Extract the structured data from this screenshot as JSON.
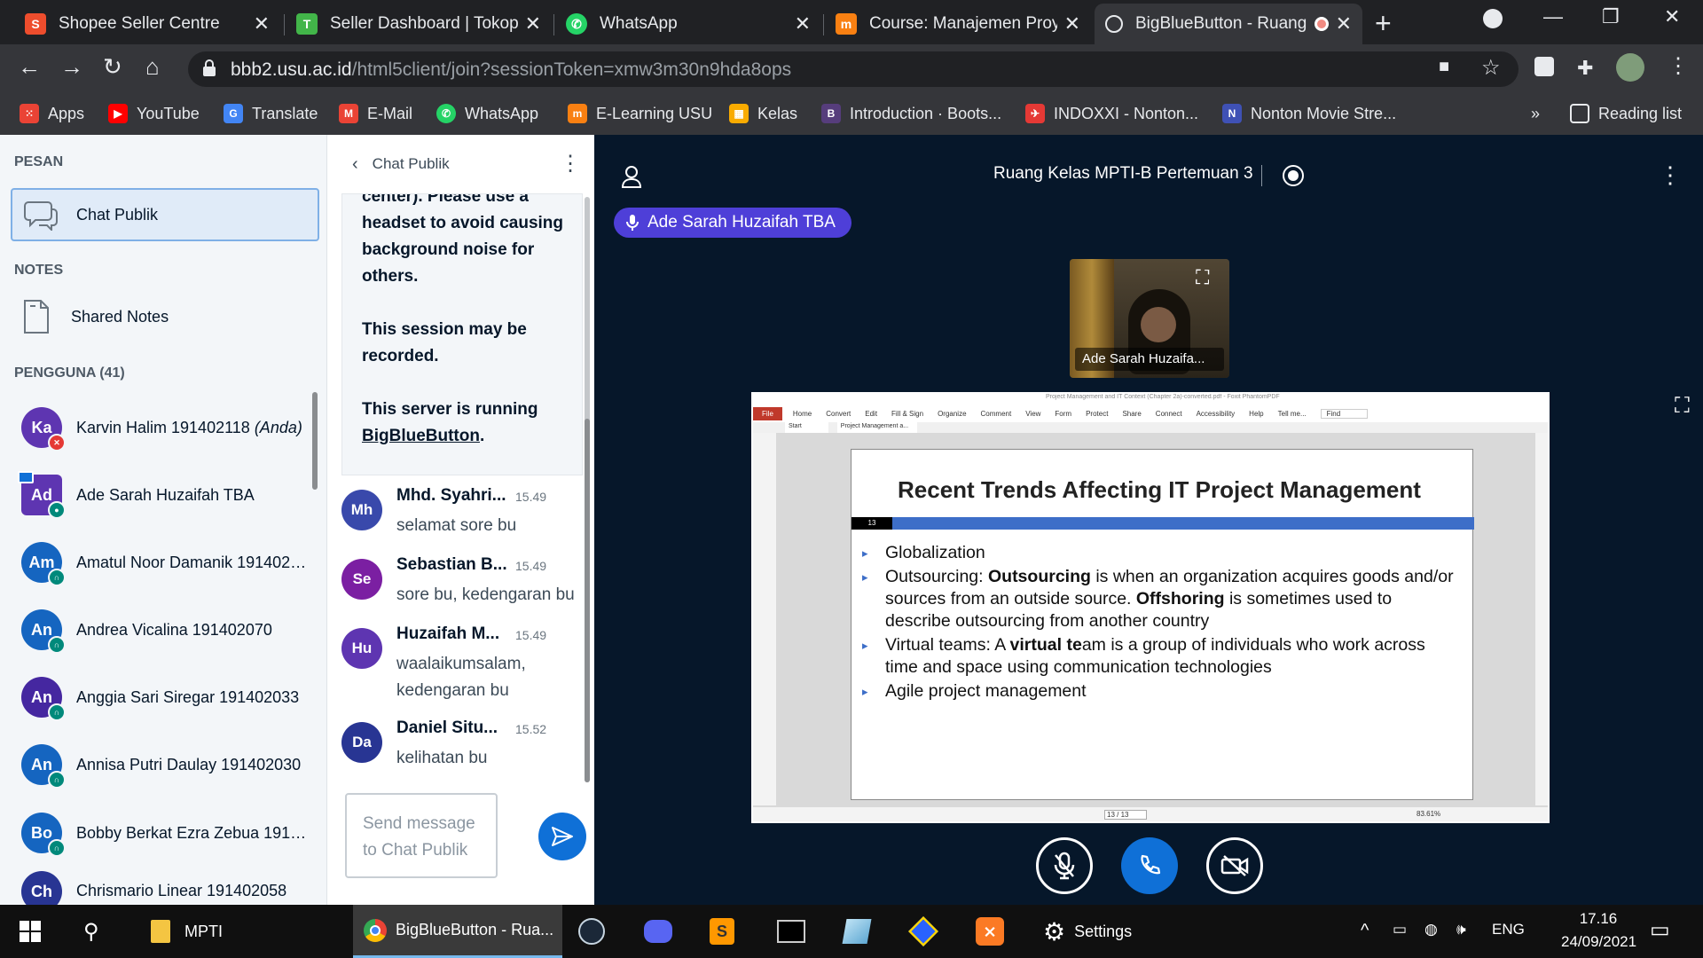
{
  "browser": {
    "tabs": [
      {
        "title": "Shopee Seller Centre",
        "icon": "shopee-icon",
        "color": "#ee4d2d"
      },
      {
        "title": "Seller Dashboard | Tokope",
        "icon": "tokopedia-icon",
        "color": "#42b549"
      },
      {
        "title": "WhatsApp",
        "icon": "whatsapp-icon",
        "color": "#25d366"
      },
      {
        "title": "Course: Manajemen Proye",
        "icon": "moodle-icon",
        "color": "#f98012"
      },
      {
        "title": "BigBlueButton - Ruang",
        "icon": "globe-icon",
        "color": "#e8eaed",
        "active": true
      }
    ],
    "url_host": "bbb2.usu.ac.id",
    "url_path": "/html5client/join?sessionToken=xmw3m30n9hda8ops",
    "bookmarks": [
      {
        "label": "Apps",
        "icon": "apps-grid-icon",
        "color": "#ea4335"
      },
      {
        "label": "YouTube",
        "icon": "youtube-icon",
        "color": "#ff0000"
      },
      {
        "label": "Translate",
        "icon": "translate-icon",
        "color": "#4285f4"
      },
      {
        "label": "E-Mail",
        "icon": "gmail-icon",
        "color": "#ea4335"
      },
      {
        "label": "WhatsApp",
        "icon": "whatsapp-icon",
        "color": "#25d366"
      },
      {
        "label": "E-Learning USU",
        "icon": "moodle-icon",
        "color": "#f98012"
      },
      {
        "label": "Kelas",
        "icon": "classroom-icon",
        "color": "#f9ab00"
      },
      {
        "label": "Introduction · Boots...",
        "icon": "bootstrap-icon",
        "color": "#563d7c"
      },
      {
        "label": "INDOXXI - Nonton...",
        "icon": "indoxxi-icon",
        "color": "#e53935"
      },
      {
        "label": "Nonton Movie Stre...",
        "icon": "movie-icon",
        "color": "#3f51b5"
      }
    ],
    "bookmarks_overflow": "»",
    "reading_list": "Reading list"
  },
  "sidebar": {
    "messages_header": "PESAN",
    "public_chat": "Chat Publik",
    "notes_header": "NOTES",
    "shared_notes": "Shared Notes",
    "users_header": "PENGGUNA (41)",
    "users": [
      {
        "initials": "Ka",
        "name": "Karvin Halim 191402118",
        "suffix": "(Anda)",
        "color": "#5e35b1",
        "badge": "mic-muted",
        "badge_color": "#e53935"
      },
      {
        "initials": "Ad",
        "name": "Ade Sarah Huzaifah TBA",
        "color": "#5e35b1",
        "badge": "mic",
        "badge_color": "#00897b",
        "presenter": true
      },
      {
        "initials": "Am",
        "name": "Amatul Noor Damanik 1914020...",
        "color": "#1565c0",
        "badge": "headset",
        "badge_color": "#00897b"
      },
      {
        "initials": "An",
        "name": "Andrea Vicalina 191402070",
        "color": "#1565c0",
        "badge": "headset",
        "badge_color": "#00897b"
      },
      {
        "initials": "An",
        "name": "Anggia Sari Siregar 191402033",
        "color": "#4527a0",
        "badge": "headset",
        "badge_color": "#00897b"
      },
      {
        "initials": "An",
        "name": "Annisa Putri Daulay 191402030",
        "color": "#1565c0",
        "badge": "headset",
        "badge_color": "#00897b"
      },
      {
        "initials": "Bo",
        "name": "Bobby Berkat Ezra Zebua 1914...",
        "color": "#1565c0",
        "badge": "headset",
        "badge_color": "#00897b"
      },
      {
        "initials": "Ch",
        "name": "Chrismario Linear 191402058",
        "color": "#283593",
        "badge": "",
        "badge_color": "#00897b"
      }
    ]
  },
  "chat": {
    "title": "Chat Publik",
    "welcome_line0": "center). Please use a",
    "welcome_line1": "headset to avoid causing background noise for others.",
    "welcome_line2": "This session may be recorded.",
    "welcome_line3": "This server is running",
    "welcome_link": "BigBlueButton",
    "welcome_end": ".",
    "messages": [
      {
        "initials": "Mh",
        "name": "Mhd. Syahri...",
        "time": "15.49",
        "text": "selamat sore bu",
        "color": "#3949ab"
      },
      {
        "initials": "Se",
        "name": "Sebastian B...",
        "time": "15.49",
        "text": "sore bu, kedengaran bu",
        "color": "#7b1fa2"
      },
      {
        "initials": "Hu",
        "name": "Huzaifah M...",
        "time": "15.49",
        "text": "waalaikumsalam, kedengaran bu",
        "color": "#5e35b1"
      },
      {
        "initials": "Da",
        "name": "Daniel Situ...",
        "time": "15.52",
        "text": "kelihatan bu",
        "color": "#283593"
      }
    ],
    "input_placeholder": "Send message to Chat Publik"
  },
  "meeting": {
    "room_title": "Ruang Kelas MPTI-B Pertemuan 3",
    "talking": "Ade Sarah Huzaifah TBA",
    "webcam_label": "Ade Sarah Huzaifa...",
    "pdf_window_title": "Project Management and IT Context (Chapter 2a)-converted.pdf - Foxit PhantomPDF",
    "pdf_menu": [
      "File",
      "Home",
      "Convert",
      "Edit",
      "Fill & Sign",
      "Organize",
      "Comment",
      "View",
      "Form",
      "Protect",
      "Share",
      "Connect",
      "Accessibility",
      "Help",
      "Tell me...",
      "Find"
    ],
    "pdf_tabs": [
      "Start",
      "Project Management a..."
    ],
    "slide_title": "Recent Trends Affecting IT Project Management",
    "slide_number": "13",
    "bullet1": "Globalization",
    "b2_a": "Outsourcing: ",
    "b2_b": "Outsourcing",
    "b2_c": " is when an organization acquires goods and/or sources from an outside source. ",
    "b2_d": "Offshoring",
    "b2_e": " is sometimes used to describe outsourcing from another country",
    "b3_a": "Virtual teams: A ",
    "b3_b": "virtual te",
    "b3_c": "am is a group of individuals who work across time and space using communication technologies",
    "bullet4": "Agile project management",
    "page_indicator": "13 / 13",
    "zoom": "83.61%"
  },
  "taskbar": {
    "folder": "MPTI",
    "chrome": "BigBlueButton - Rua...",
    "settings": "Settings",
    "lang": "ENG",
    "time": "17.16",
    "date": "24/09/2021"
  }
}
